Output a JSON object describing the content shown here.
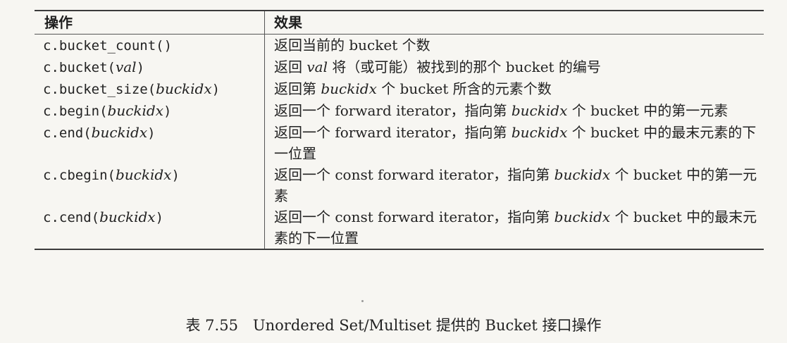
{
  "table": {
    "header": {
      "op": "操作",
      "effect": "效果"
    },
    "rows": [
      {
        "op_prefix": "c.bucket_count()",
        "op_arg": "",
        "op_suffix": "",
        "effect": [
          {
            "t": "返回当前的 bucket 个数"
          }
        ]
      },
      {
        "op_prefix": "c.bucket(",
        "op_arg": "val",
        "op_suffix": ")",
        "effect": [
          {
            "t": "返回 "
          },
          {
            "t": "val",
            "i": true
          },
          {
            "t": " 将（或可能）被找到的那个 bucket 的编号"
          }
        ]
      },
      {
        "op_prefix": "c.bucket_size(",
        "op_arg": "buckidx",
        "op_suffix": ")",
        "effect": [
          {
            "t": "返回第 "
          },
          {
            "t": "buckidx",
            "i": true
          },
          {
            "t": " 个 bucket 所含的元素个数"
          }
        ]
      },
      {
        "op_prefix": "c.begin(",
        "op_arg": "buckidx",
        "op_suffix": ")",
        "effect": [
          {
            "t": "返回一个 forward iterator，指向第 "
          },
          {
            "t": "buckidx",
            "i": true
          },
          {
            "t": " 个 bucket 中的第一元素"
          }
        ]
      },
      {
        "op_prefix": "c.end(",
        "op_arg": "buckidx",
        "op_suffix": ")",
        "effect": [
          {
            "t": "返回一个 forward iterator，指向第 "
          },
          {
            "t": "buckidx",
            "i": true
          },
          {
            "t": " 个 bucket 中的最末元素的下一位置"
          }
        ]
      },
      {
        "op_prefix": "c.cbegin(",
        "op_arg": "buckidx",
        "op_suffix": ")",
        "effect": [
          {
            "t": "返回一个 const forward iterator，指向第 "
          },
          {
            "t": "buckidx",
            "i": true
          },
          {
            "t": " 个 bucket 中的第一元素"
          }
        ]
      },
      {
        "op_prefix": "c.cend(",
        "op_arg": "buckidx",
        "op_suffix": ")",
        "effect": [
          {
            "t": "返回一个 const forward iterator，指向第 "
          },
          {
            "t": "buckidx",
            "i": true
          },
          {
            "t": " 个 bucket 中的最末元素的下一位置"
          }
        ]
      }
    ]
  },
  "caption": "表 7.55　Unordered Set/Multiset 提供的 Bucket 接口操作"
}
